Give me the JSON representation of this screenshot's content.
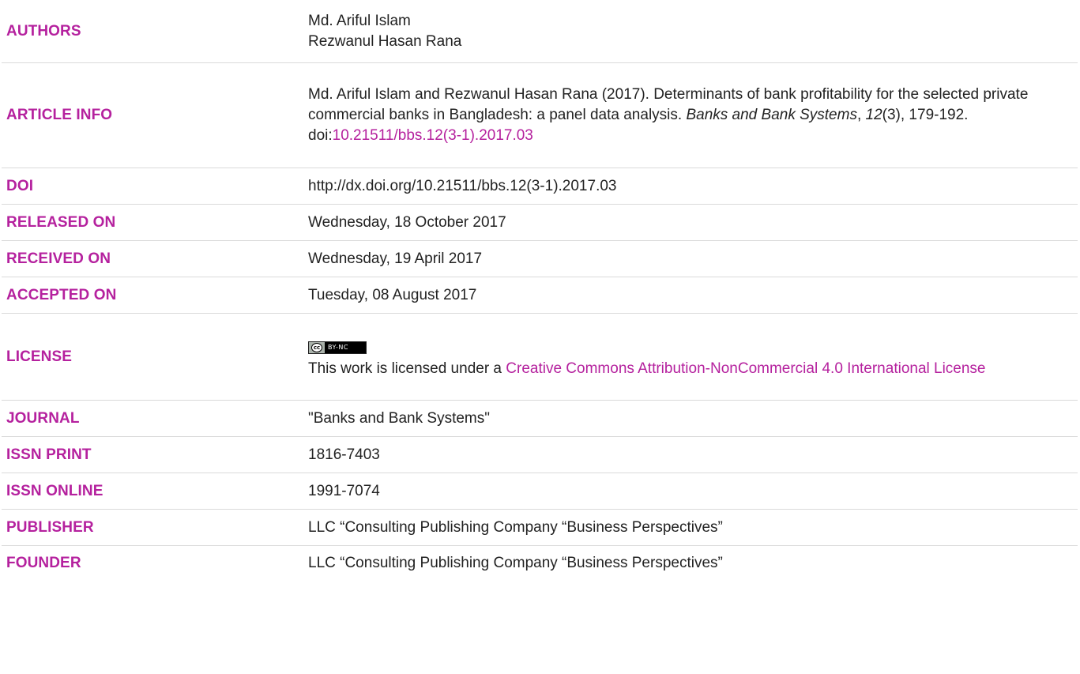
{
  "rows": {
    "authors": {
      "label": "AUTHORS",
      "names": [
        "Md. Ariful Islam",
        "Rezwanul Hasan Rana"
      ]
    },
    "article_info": {
      "label": "ARTICLE INFO",
      "text_part1": "Md. Ariful Islam and Rezwanul Hasan Rana (2017). Determinants of bank profitability for the selected private commercial banks in Bangladesh: a panel data analysis. ",
      "journal_italic": "Banks and Bank Systems",
      "comma1": ", ",
      "volume_italic": "12",
      "issue_pages": "(3), 179-192. doi:",
      "doi_link": "10.21511/bbs.12(3-1).2017.03"
    },
    "doi": {
      "label": "DOI",
      "value": "http://dx.doi.org/10.21511/bbs.12(3-1).2017.03"
    },
    "released_on": {
      "label": "RELEASED ON",
      "value": "Wednesday, 18 October 2017"
    },
    "received_on": {
      "label": "RECEIVED ON",
      "value": "Wednesday, 19 April 2017"
    },
    "accepted_on": {
      "label": "ACCEPTED ON",
      "value": "Tuesday, 08 August 2017"
    },
    "license": {
      "label": "LICENSE",
      "badge_cc": "cc",
      "badge_terms": "BY-NC",
      "text_prefix": "This work is licensed under a ",
      "link_text": "Creative Commons Attribution-NonCommercial 4.0 International License"
    },
    "journal": {
      "label": "JOURNAL",
      "value": "\"Banks and Bank Systems\""
    },
    "issn_print": {
      "label": "ISSN PRINT",
      "value": "1816-7403"
    },
    "issn_online": {
      "label": "ISSN ONLINE",
      "value": "1991-7074"
    },
    "publisher": {
      "label": "PUBLISHER",
      "value": "LLC “Consulting Publishing Company “Business Perspectives”"
    },
    "founder": {
      "label": "FOUNDER",
      "value": "LLC “Consulting Publishing Company “Business Perspectives”"
    }
  },
  "colors": {
    "label_accent": "#b5219e",
    "text": "#222222",
    "divider": "#dadada"
  }
}
